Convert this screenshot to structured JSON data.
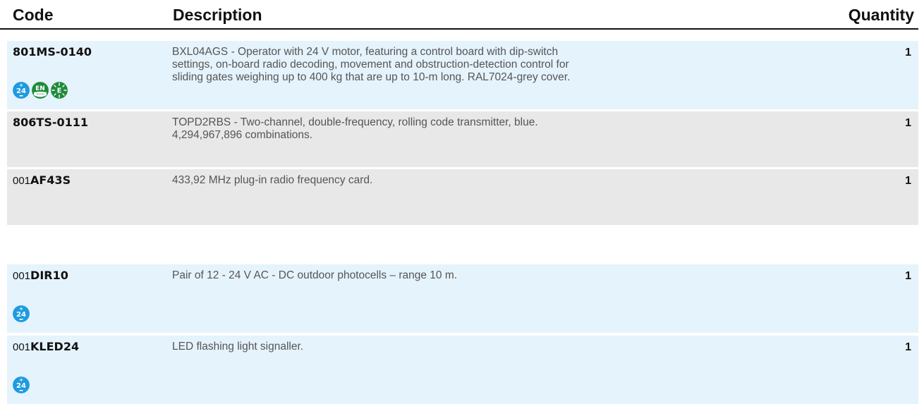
{
  "header": {
    "code_label": "Code",
    "description_label": "Description",
    "quantity_label": "Quantity"
  },
  "rows": [
    {
      "code_prefix": "",
      "code": "801MS-0140",
      "description_lines": [
        "BXL04AGS - Operator with 24 V motor, featuring a control board with dip-switch",
        "settings, on-board radio decoding, movement and obstruction-detection control for",
        "sliding gates weighing up to 400 kg that are up to 10-m long. RAL7024-grey cover."
      ],
      "quantity": "1",
      "badges": [
        "24v-icon",
        "en-tested-icon",
        "energy-icon"
      ]
    },
    {
      "code_prefix": "",
      "code": "806TS-0111",
      "description_lines": [
        "TOPD2RBS - Two-channel, double-frequency, rolling code transmitter, blue.",
        "4,294,967,896 combinations."
      ],
      "quantity": "1",
      "badges": []
    },
    {
      "code_prefix": "001",
      "code": "AF43S",
      "description_lines": [
        "433,92 MHz plug-in radio frequency card."
      ],
      "quantity": "1",
      "badges": []
    },
    {
      "code_prefix": "001",
      "code": "DIR10",
      "description_lines": [
        "Pair of 12 - 24 V AC - DC  outdoor photocells – range 10 m."
      ],
      "quantity": "1",
      "badges": [
        "24v-icon"
      ]
    },
    {
      "code_prefix": "001",
      "code": "KLED24",
      "description_lines": [
        "LED flashing light signaller."
      ],
      "quantity": "1",
      "badges": [
        "24v-icon"
      ]
    }
  ],
  "badge_text": {
    "v24": "24",
    "en": "EN",
    "tested": "TESTED",
    "energy": "E"
  },
  "colors": {
    "row_blue": "#e5f3fc",
    "row_grey": "#e8e8e8",
    "badge_blue": "#1e9be0",
    "badge_green": "#1f8a3b"
  }
}
